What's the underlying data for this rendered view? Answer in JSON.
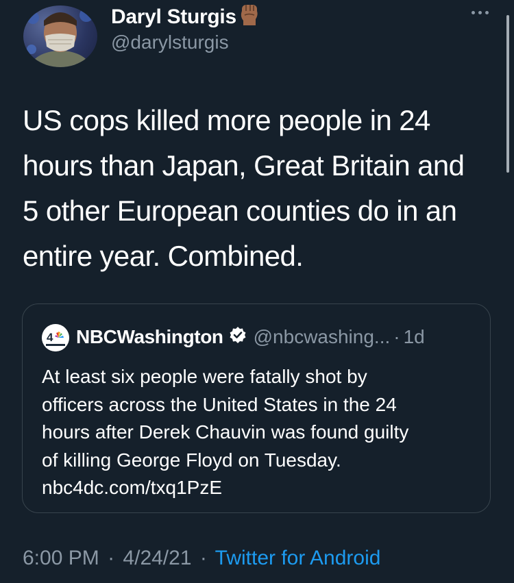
{
  "author": {
    "name": "Daryl Sturgis",
    "handle": "@darylsturgis",
    "avatar_icon": "profile-photo-masked-man",
    "badge_icon": "raised-fist-emoji"
  },
  "more_icon": "ellipsis-icon",
  "tweet": {
    "lines": [
      "US cops killed more people in 24",
      "hours than Japan, Great Britain and",
      "5 other European counties do in an",
      "entire year. Combined."
    ]
  },
  "quoted_tweet": {
    "name": "NBCWashington",
    "handle": "@nbcwashing...",
    "separator": "·",
    "time": "1d",
    "logo_icon": "nbc4-washington-logo",
    "verified_icon": "verified-badge-icon",
    "lines": [
      "At least six people were fatally shot by",
      "officers across the United States in the 24",
      "hours after Derek Chauvin was found guilty",
      "of killing George Floyd on Tuesday.",
      "nbc4dc.com/txq1PzE"
    ]
  },
  "meta": {
    "time": "6:00 PM",
    "separator": "·",
    "date": "4/24/21",
    "source": "Twitter for Android"
  },
  "colors": {
    "background": "#15202b",
    "text": "#ffffff",
    "secondary": "#8b98a5",
    "accent": "#1d9bf0",
    "border": "#38444d"
  }
}
